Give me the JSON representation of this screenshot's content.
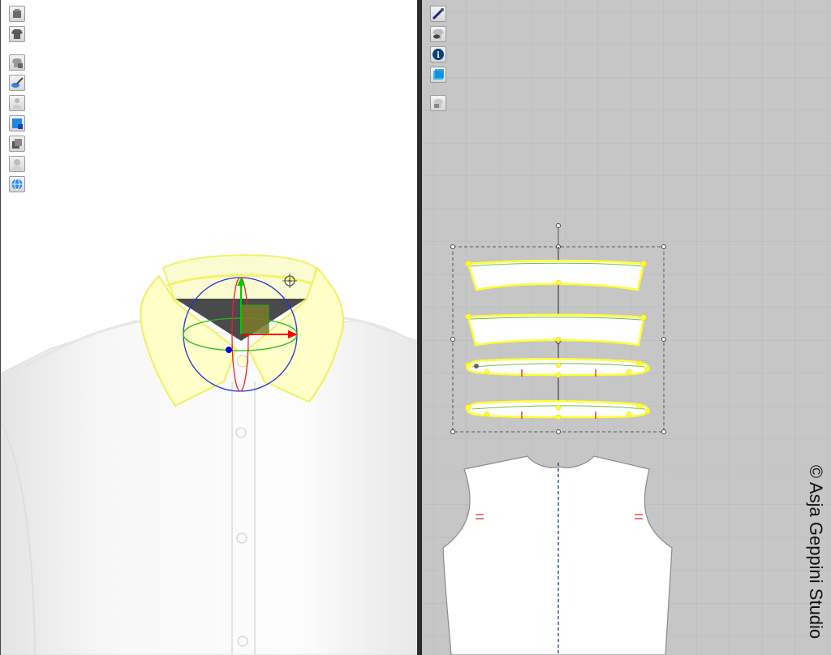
{
  "viewport_3d": {
    "toolbar_icons": [
      "avatar-display-icon",
      "garment-display-icon",
      "texture-view-icon",
      "visibility-brush-icon",
      "avatar-silhouette-icon",
      "fabric-color-icon",
      "layer-icon",
      "avatar-gray-icon",
      "globe-icon"
    ]
  },
  "viewport_2d": {
    "toolbar_icons": [
      "edit-pattern-icon",
      "garment-visibility-icon",
      "info-icon",
      "fabric-texture-icon",
      "lock-garment-icon"
    ]
  },
  "watermark": {
    "text": "© Asja Geppini Studio"
  },
  "colors": {
    "highlight": "#ffff33",
    "selection": "#ffffc8",
    "grid": "#b8b8b8",
    "panel_2d": "#c6c6c6",
    "gizmo_x": "#ff0000",
    "gizmo_y": "#00cc00",
    "gizmo_z": "#0000ff"
  }
}
